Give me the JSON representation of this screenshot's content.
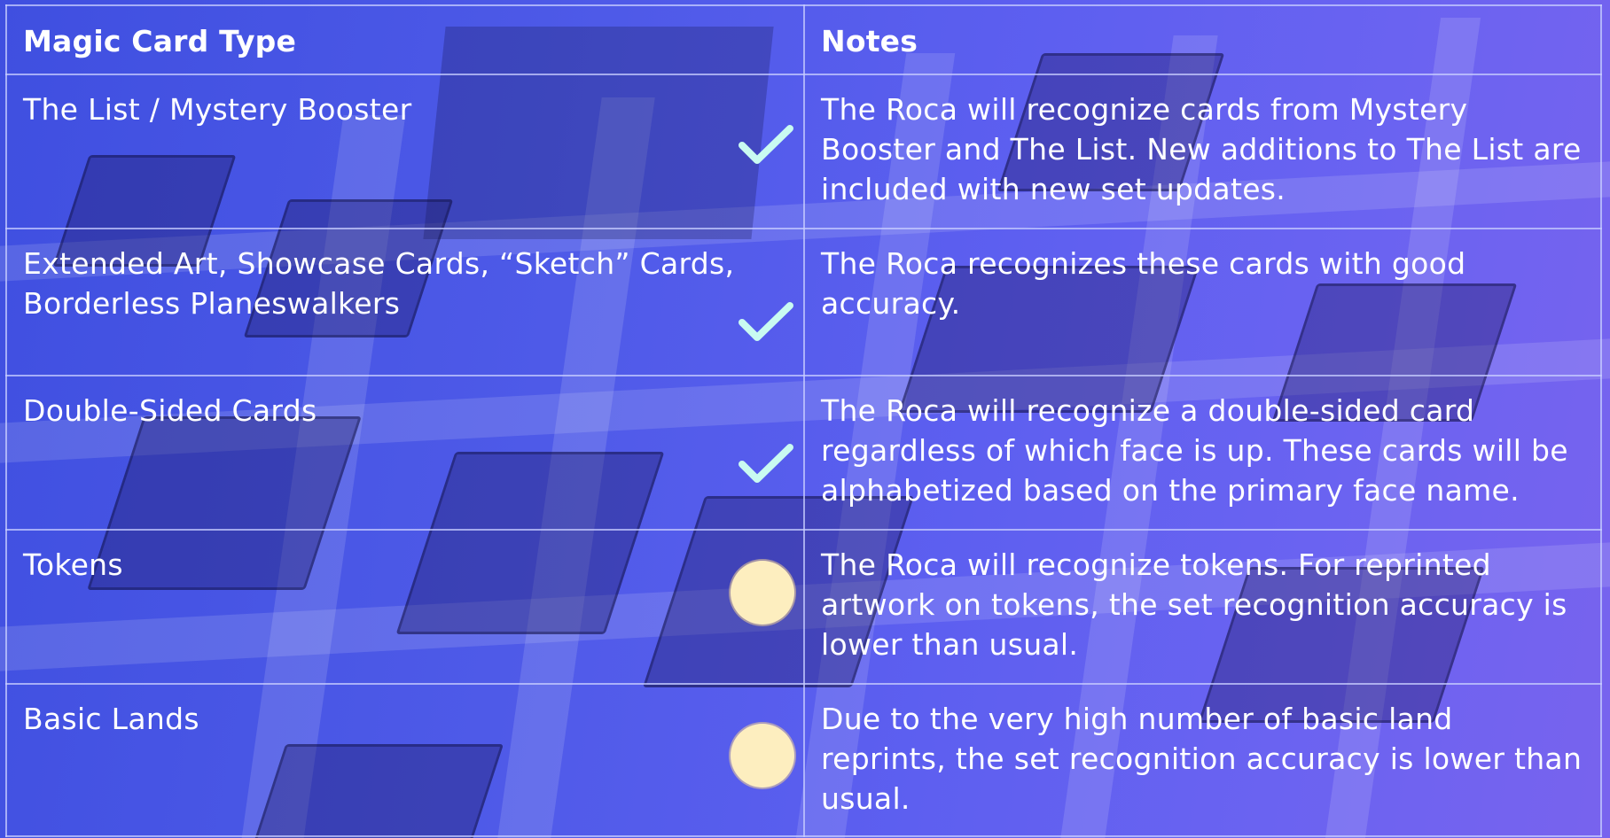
{
  "table": {
    "headers": {
      "type": "Magic Card Type",
      "notes": "Notes"
    },
    "rows": [
      {
        "type": "The List / Mystery Booster",
        "status": "check",
        "notes": "The Roca will recognize cards from Mystery Booster and The List.  New additions to The List are included with new set updates."
      },
      {
        "type": "Extended Art, Showcase Cards, “Sketch” Cards, Borderless Planeswalkers",
        "status": "check",
        "notes": "The Roca recognizes these cards with good accuracy."
      },
      {
        "type": "Double-Sided Cards",
        "status": "check",
        "notes": "The Roca will recognize a double-sided card regardless of which face is up.  These cards will be alphabetized based on the primary face name."
      },
      {
        "type": "Tokens",
        "status": "partial",
        "notes": "The Roca will recognize tokens.  For reprinted artwork on tokens, the set recognition accuracy is lower than usual."
      },
      {
        "type": "Basic Lands",
        "status": "partial",
        "notes": "Due to the very high number of basic land reprints, the set recognition accuracy is lower than usual."
      }
    ]
  },
  "icons": {
    "check": "check-icon",
    "partial": "circle-icon"
  },
  "colors": {
    "check": "#c9fbf1",
    "partial": "#fdeebf",
    "background_start": "#3f4fe0",
    "background_end": "#7863ee",
    "grid_line": "#c8cdff"
  }
}
